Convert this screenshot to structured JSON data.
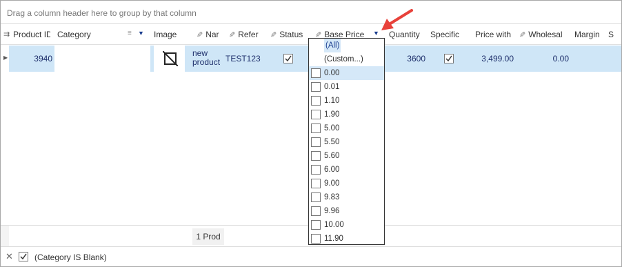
{
  "group_panel": {
    "hint": "Drag a column header here to group by that column"
  },
  "columns": {
    "product_id": "Product ID",
    "category": "Category",
    "image": "Image",
    "name": "Nar",
    "reference": "Refer",
    "status": "Status",
    "base_price": "Base Price",
    "quantity": "Quantity",
    "specific": "Specific",
    "price_with": "Price with",
    "wholesale": "Wholesal",
    "margin": "Margin",
    "extra": "S"
  },
  "row": {
    "product_id": "3940",
    "name_line1": "new",
    "name_line2": "product",
    "reference": "TEST123",
    "status_checked": true,
    "quantity": "3600",
    "specific_checked": true,
    "price_with": "3,499.00",
    "wholesale": "0.00"
  },
  "filter_dropdown": {
    "all_label": "(All)",
    "custom_label": "(Custom...)",
    "values": [
      "0.00",
      "0.01",
      "1.10",
      "1.90",
      "5.00",
      "5.50",
      "5.60",
      "6.00",
      "9.00",
      "9.83",
      "9.96",
      "10.00",
      "11.90"
    ],
    "highlighted_value": "0.00"
  },
  "footer": {
    "summary": "1 Prod"
  },
  "filter_bar": {
    "expression": "(Category IS Blank)",
    "enabled": true
  },
  "colors": {
    "selected_row": "#cfe6f7",
    "text_dark_blue": "#1e2f6b",
    "highlight": "#d5e8f8",
    "arrow": "#e8413a"
  },
  "icons": [
    "group-panel-icon",
    "pencil-icon",
    "sort-icon",
    "filter-icon",
    "no-image-icon",
    "checkbox",
    "close-icon",
    "red-arrow"
  ]
}
